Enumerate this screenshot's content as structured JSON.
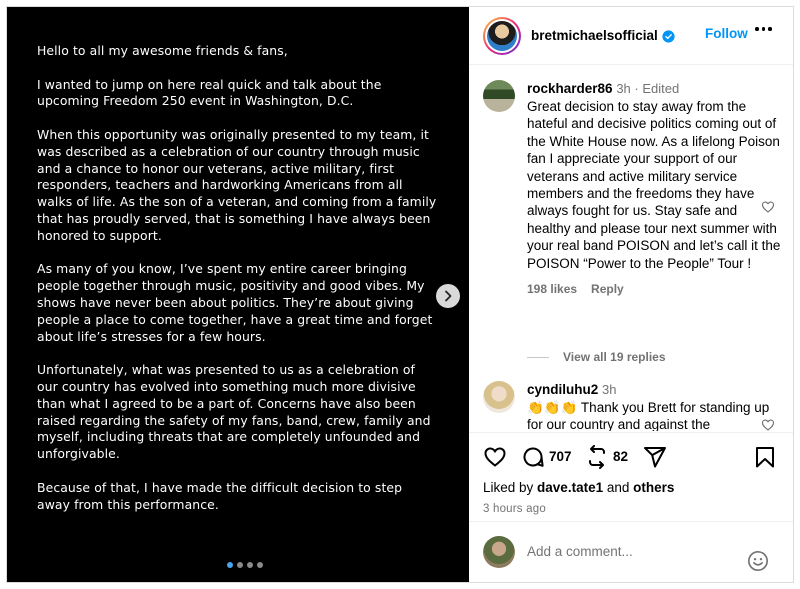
{
  "post_text": [
    "Hello to all my awesome friends & fans,",
    "I wanted to jump on here real quick and talk about the upcoming Freedom 250 event in Washington, D.C.",
    "When this opportunity was originally presented to my team, it was described as a celebration of our country through music and a chance to honor our veterans, active military, first responders, teachers and hardworking Americans from all walks of life. As the son of a veteran, and coming from a family that has proudly served, that is something I have always been honored to support.",
    "As many of you know, I’ve spent my entire career bringing people together through music, positivity and good vibes. My shows have never been about politics. They’re about giving people a place to come together, have a great time and forget about life’s stresses for a few hours.",
    "Unfortunately, what was presented to us as a celebration of our country has evolved into something much more divisive than what I agreed to be a part of. Concerns have also been raised regarding the safety of my fans, band, crew, family and myself, including threats that are completely unfounded and unforgivable.",
    "Because of that, I have made the difficult decision to step away from this performance."
  ],
  "carousel": {
    "current": 1,
    "total": 4
  },
  "header": {
    "username": "bretmichaelsofficial",
    "verified": true,
    "follow_label": "Follow"
  },
  "comments": [
    {
      "username": "rockharder86",
      "meta": "3h · Edited",
      "text": "Great decision to stay away from the hateful and decisive politics coming out of the White House now. As a lifelong Poison fan I appreciate your support of our veterans and active military service members and the freedoms they have always fought for us. Stay safe and healthy and please tour next summer with your real band POISON and let’s call it the POISON “Power to the People” Tour !",
      "likes": "198 likes",
      "reply_label": "Reply",
      "view_replies": "View all 19 replies"
    },
    {
      "username": "cyndiluhu2",
      "meta": "3h",
      "text": "👏👏👏 Thank you Brett for standing up for our country and against the"
    }
  ],
  "stats": {
    "comments": "707",
    "reposts": "82"
  },
  "liked_by": {
    "prefix": "Liked by ",
    "user": "dave.tate1",
    "and": " and ",
    "others": "others"
  },
  "time_ago": "3 hours ago",
  "add_comment": {
    "placeholder": "Add a comment..."
  },
  "colors": {
    "accent": "#0095f6",
    "muted": "#737373",
    "media_bg": "#000000"
  }
}
